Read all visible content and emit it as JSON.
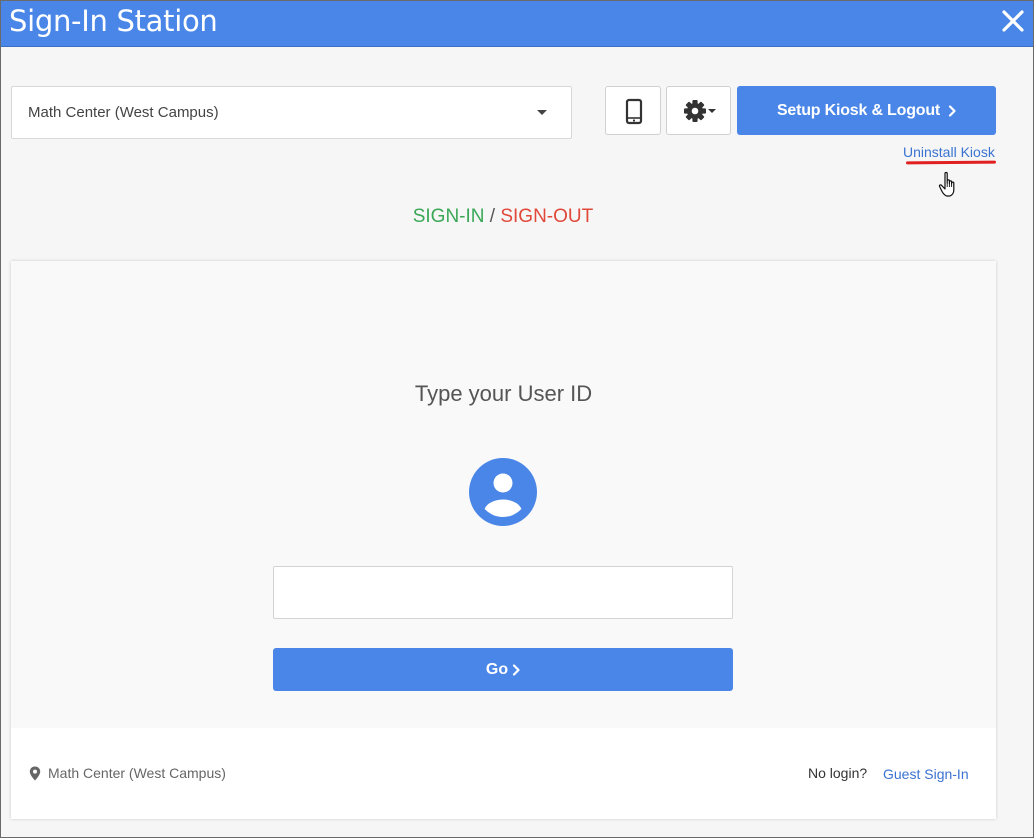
{
  "window": {
    "title": "Sign-In Station"
  },
  "toolbar": {
    "location_selected": "Math Center (West Campus)",
    "setup_button_label": "Setup Kiosk & Logout",
    "uninstall_link": "Uninstall Kiosk"
  },
  "mode": {
    "sign_in": "SIGN-IN",
    "separator": "/",
    "sign_out": "SIGN-OUT"
  },
  "card": {
    "prompt": "Type your User ID",
    "input_value": "",
    "go_label": "Go"
  },
  "footer": {
    "location": "Math Center (West Campus)",
    "no_login": "No login?",
    "guest_link": "Guest Sign-In"
  },
  "colors": {
    "primary": "#4a86e8",
    "sign_in": "#3aa856",
    "sign_out": "#e0483a",
    "link": "#3a73d0",
    "highlight": "#e02020"
  },
  "icons": {
    "close": "close-icon",
    "dropdown": "chevron-down-icon",
    "mobile": "mobile-phone-icon",
    "settings": "gear-icon",
    "avatar": "user-avatar-icon",
    "location": "map-pin-icon",
    "cursor": "hand-pointer-icon"
  }
}
